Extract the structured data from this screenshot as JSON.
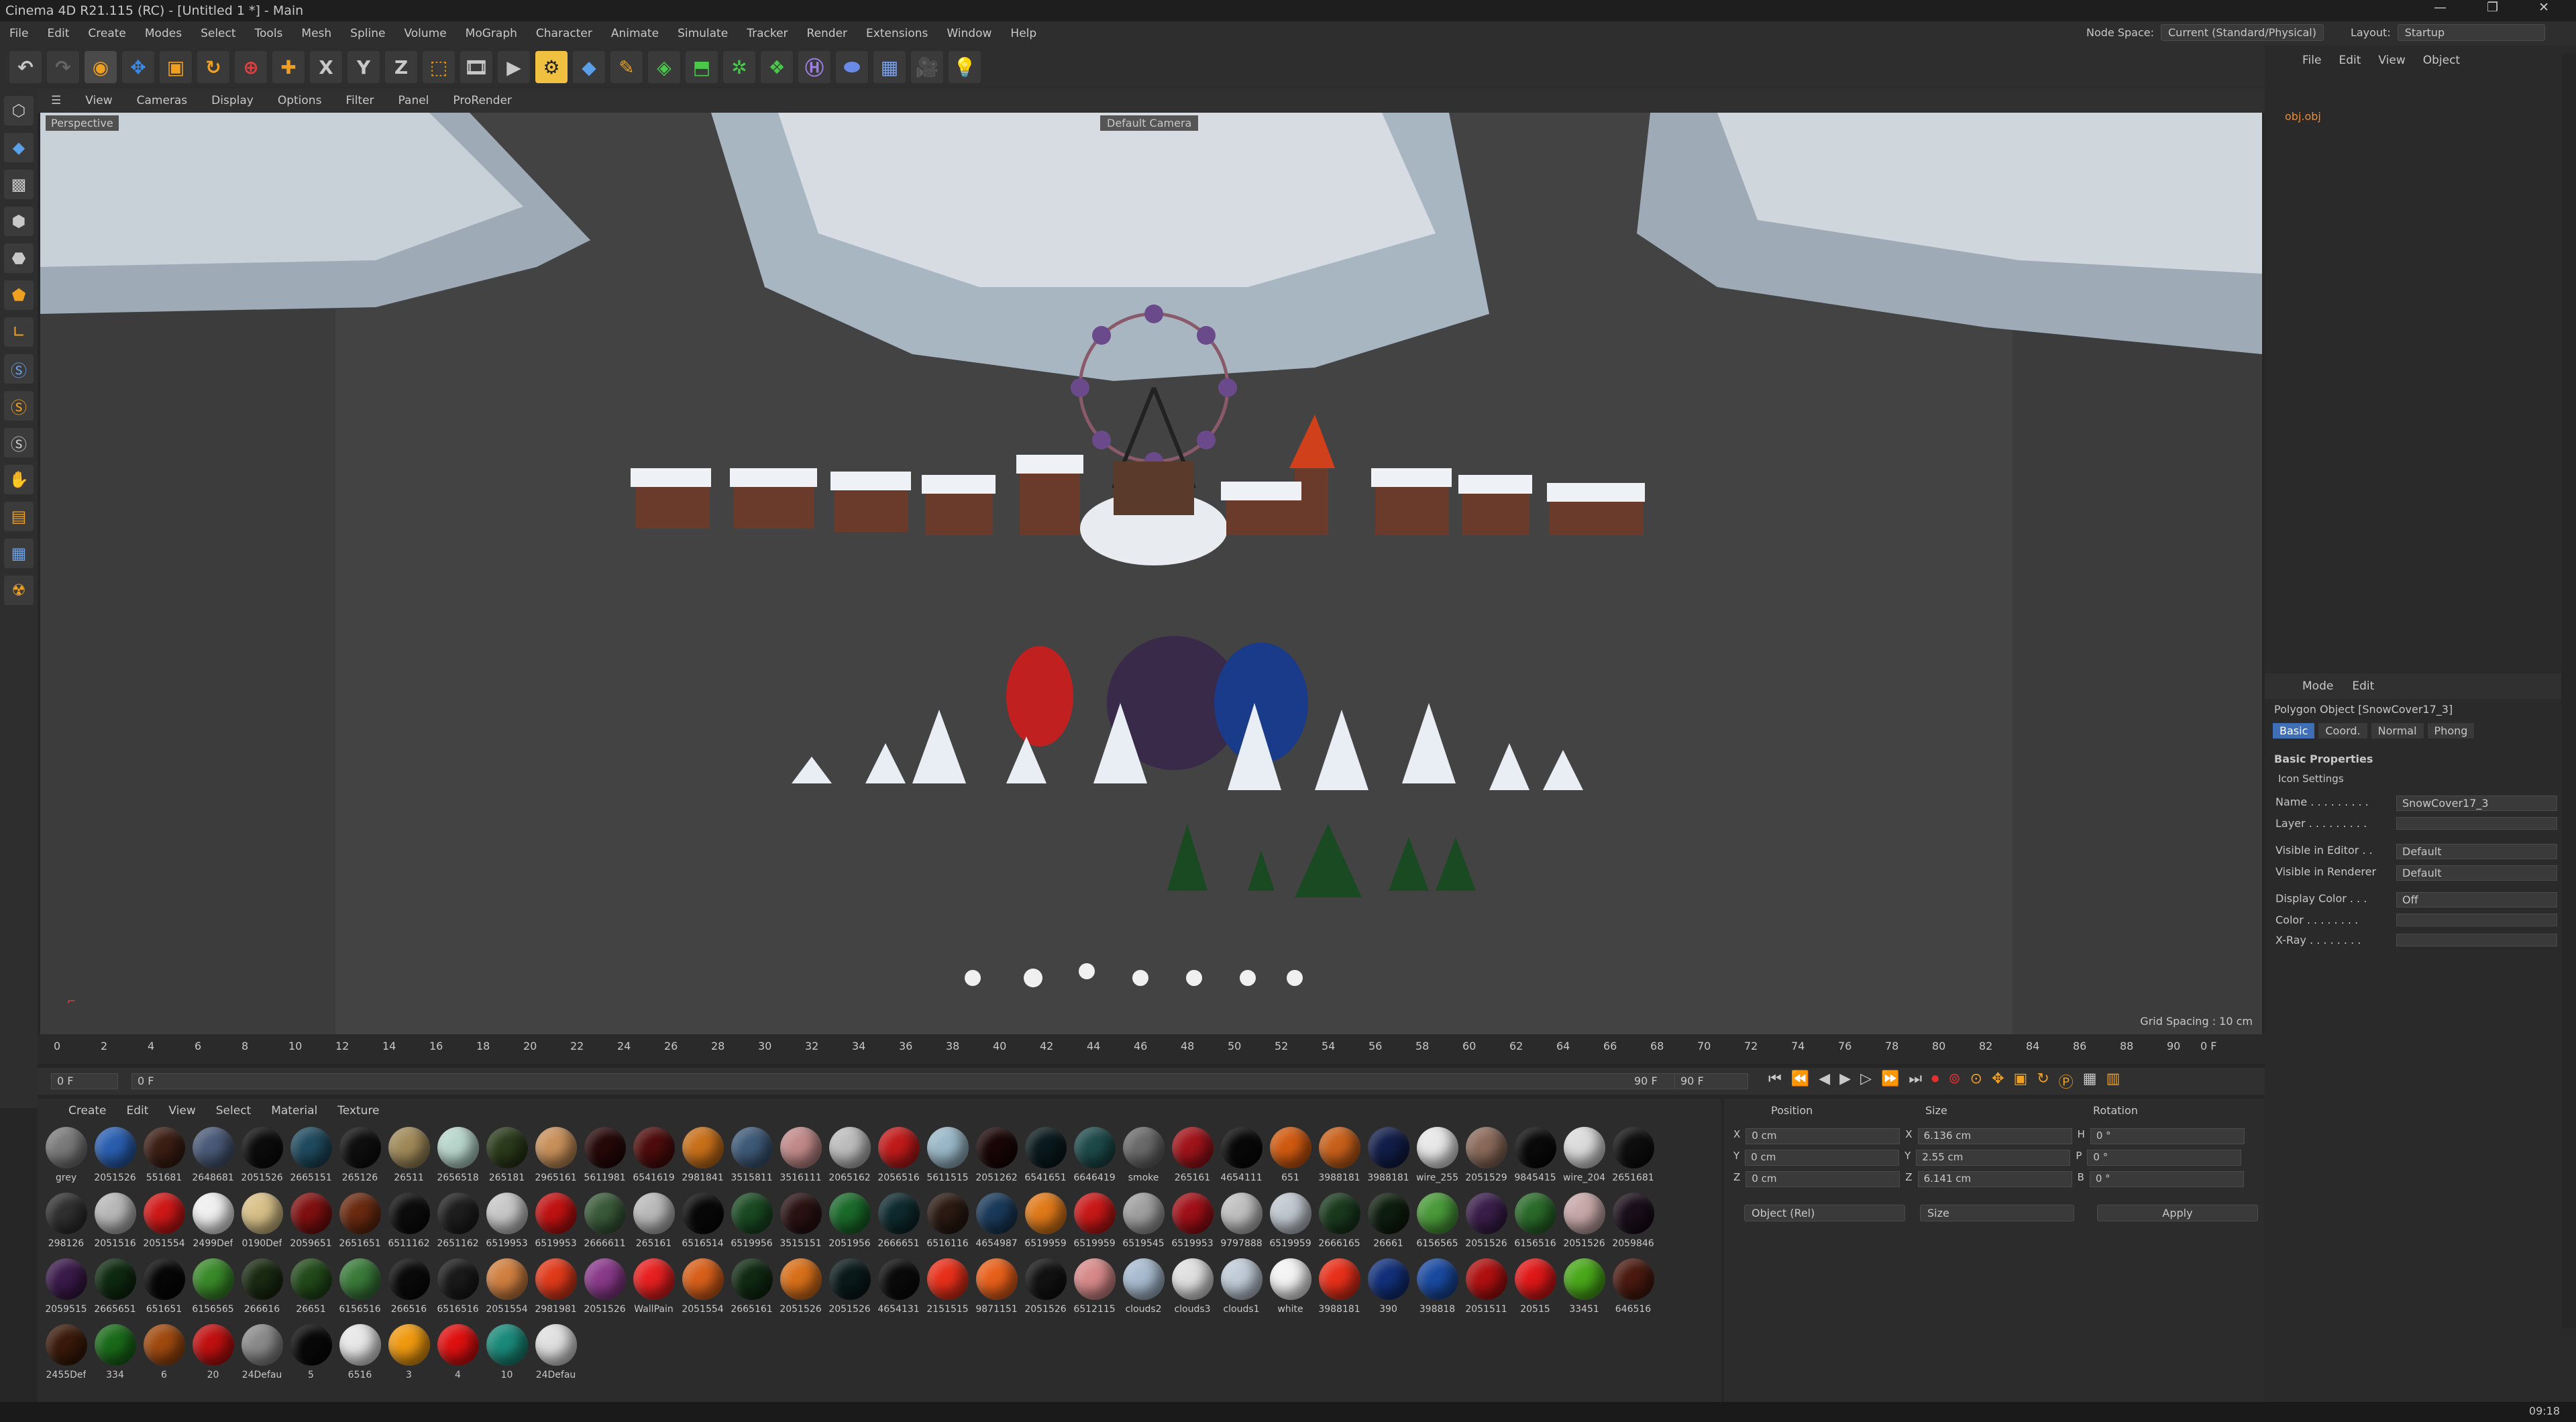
{
  "window": {
    "title": "Cinema 4D R21.115 (RC) - [Untitled 1 *] - Main"
  },
  "menu": [
    "File",
    "Edit",
    "Create",
    "Modes",
    "Select",
    "Tools",
    "Mesh",
    "Spline",
    "Volume",
    "MoGraph",
    "Character",
    "Animate",
    "Simulate",
    "Tracker",
    "Render",
    "Extensions",
    "Window",
    "Help"
  ],
  "node_space": {
    "label": "Node Space:",
    "value": "Current (Standard/Physical)"
  },
  "layout": {
    "label": "Layout:",
    "value": "Startup"
  },
  "toolbar": {
    "x": "X",
    "y": "Y",
    "z": "Z"
  },
  "viewport": {
    "menu": [
      "View",
      "Cameras",
      "Display",
      "Options",
      "Filter",
      "Panel",
      "ProRender"
    ],
    "label": "Perspective",
    "camera": "Default Camera",
    "grid": "Grid Spacing : 10 cm"
  },
  "timeline": {
    "ticks": [
      "0",
      "2",
      "4",
      "6",
      "8",
      "10",
      "12",
      "14",
      "16",
      "18",
      "20",
      "22",
      "24",
      "26",
      "28",
      "30",
      "32",
      "34",
      "36",
      "38",
      "40",
      "42",
      "44",
      "46",
      "48",
      "50",
      "52",
      "54",
      "56",
      "58",
      "60",
      "62",
      "64",
      "66",
      "68",
      "70",
      "72",
      "74",
      "76",
      "78",
      "80",
      "82",
      "84",
      "86",
      "88",
      "90"
    ],
    "end": "0 F",
    "start_frame": "0 F",
    "cur_frame": "0 F",
    "end_frame": "90 F",
    "max_frame": "90 F"
  },
  "materials": {
    "menu": [
      "Create",
      "Edit",
      "View",
      "Select",
      "Material",
      "Texture"
    ],
    "items": [
      {
        "n": "grey",
        "c": "#7a7a7a"
      },
      {
        "n": "2051526",
        "c": "#2a5fb0"
      },
      {
        "n": "551681",
        "c": "#3b1e14"
      },
      {
        "n": "2648681",
        "c": "#4a5a78"
      },
      {
        "n": "2051526",
        "c": "#0c0c0c"
      },
      {
        "n": "2665151",
        "c": "#1f4a5e"
      },
      {
        "n": "265126",
        "c": "#0f0f0f"
      },
      {
        "n": "26511",
        "c": "#a08a5a"
      },
      {
        "n": "2656518",
        "c": "#b8d6cc"
      },
      {
        "n": "265181",
        "c": "#2a3a1a"
      },
      {
        "n": "2965161",
        "c": "#c8905a"
      },
      {
        "n": "5611981",
        "c": "#260808"
      },
      {
        "n": "6541619",
        "c": "#4e0c0c"
      },
      {
        "n": "2981841",
        "c": "#c8701a"
      },
      {
        "n": "3515811",
        "c": "#3e5a78"
      },
      {
        "n": "3516111",
        "c": "#c28a8a"
      },
      {
        "n": "2065162",
        "c": "#bdbdbd"
      },
      {
        "n": "2056516",
        "c": "#c01a1a"
      },
      {
        "n": "5611515",
        "c": "#9ab8c8"
      },
      {
        "n": "2051262",
        "c": "#1a0606"
      },
      {
        "n": "6541651",
        "c": "#0a1a1e"
      },
      {
        "n": "6646419",
        "c": "#1e4a4a"
      },
      {
        "n": "smoke",
        "c": "#6a6a6a"
      },
      {
        "n": "265161",
        "c": "#a0141a"
      },
      {
        "n": "4654111",
        "c": "#080808"
      },
      {
        "n": "651",
        "c": "#d05a10"
      },
      {
        "n": "3988181",
        "c": "#c8601a"
      },
      {
        "n": "3988181",
        "c": "#121e4a"
      },
      {
        "n": "wire_255",
        "c": "#e8e8e8"
      },
      {
        "n": "2051529",
        "c": "#8a6a5a"
      },
      {
        "n": "9845415",
        "c": "#0a0a0a"
      },
      {
        "n": "wire_204",
        "c": "#dcdcdc"
      },
      {
        "n": "2651681",
        "c": "#0e0e0e"
      },
      {
        "n": "298126",
        "c": "#303030"
      },
      {
        "n": "2051516",
        "c": "#b8b8b8"
      },
      {
        "n": "2051554",
        "c": "#d01818"
      },
      {
        "n": "2499Def",
        "c": "#f0f0f0"
      },
      {
        "n": "0190Def",
        "c": "#d8c088"
      },
      {
        "n": "2059651",
        "c": "#801010"
      },
      {
        "n": "2651651",
        "c": "#6a2a10"
      },
      {
        "n": "6511162",
        "c": "#0c0c0c"
      },
      {
        "n": "2651162",
        "c": "#1e1e1e"
      },
      {
        "n": "6519953",
        "c": "#c8c8c8"
      },
      {
        "n": "6519953",
        "c": "#c01212"
      },
      {
        "n": "2666611",
        "c": "#3a5a3a"
      },
      {
        "n": "265161",
        "c": "#bababa"
      },
      {
        "n": "6516514",
        "c": "#080808"
      },
      {
        "n": "6519956",
        "c": "#1a4a22"
      },
      {
        "n": "3515151",
        "c": "#2a1212"
      },
      {
        "n": "2051956",
        "c": "#1a6a2a"
      },
      {
        "n": "2666651",
        "c": "#0e2a2e"
      },
      {
        "n": "6516116",
        "c": "#2a1a12"
      },
      {
        "n": "4654987",
        "c": "#1a3a5a"
      },
      {
        "n": "6519959",
        "c": "#e07a1a"
      },
      {
        "n": "6519959",
        "c": "#c81818"
      },
      {
        "n": "6519545",
        "c": "#a0a0a0"
      },
      {
        "n": "6519953",
        "c": "#a01018"
      },
      {
        "n": "9797888",
        "c": "#c0c0c0"
      },
      {
        "n": "6519959",
        "c": "#c0c8d0"
      },
      {
        "n": "2666165",
        "c": "#1a3a1e"
      },
      {
        "n": "26661",
        "c": "#0e1e0e"
      },
      {
        "n": "6156565",
        "c": "#4a9a3a"
      },
      {
        "n": "2051526",
        "c": "#3a1e4a"
      },
      {
        "n": "6156516",
        "c": "#2a6a2a"
      },
      {
        "n": "2051526",
        "c": "#c8a8a8"
      },
      {
        "n": "2059846",
        "c": "#1a0e1a"
      },
      {
        "n": "2059515",
        "c": "#3a1a4a"
      },
      {
        "n": "2665651",
        "c": "#0e2a10"
      },
      {
        "n": "651651",
        "c": "#060606"
      },
      {
        "n": "6156565",
        "c": "#3a8a2a"
      },
      {
        "n": "266616",
        "c": "#1a2a12"
      },
      {
        "n": "26651",
        "c": "#224a1a"
      },
      {
        "n": "6156516",
        "c": "#3a7a3a"
      },
      {
        "n": "266516",
        "c": "#0a0a0a"
      },
      {
        "n": "6516516",
        "c": "#1a1a1a"
      },
      {
        "n": "2051554",
        "c": "#d08040"
      },
      {
        "n": "2981981",
        "c": "#e03a1a"
      },
      {
        "n": "2051526",
        "c": "#8a3a8a"
      },
      {
        "n": "WallPain",
        "c": "#e82020"
      },
      {
        "n": "2051554",
        "c": "#d8601a"
      },
      {
        "n": "2665161",
        "c": "#102a12"
      },
      {
        "n": "2051526",
        "c": "#d8701a"
      },
      {
        "n": "2051526",
        "c": "#0a1a1a"
      },
      {
        "n": "4654131",
        "c": "#0a0a0a"
      },
      {
        "n": "2151515",
        "c": "#e8301a"
      },
      {
        "n": "9871151",
        "c": "#e8601a"
      },
      {
        "n": "2051526",
        "c": "#121212"
      },
      {
        "n": "6512115",
        "c": "#d88a8a"
      },
      {
        "n": "clouds2",
        "c": "#a8bcd0"
      },
      {
        "n": "clouds3",
        "c": "#e0e0e0"
      },
      {
        "n": "clouds1",
        "c": "#c0ccd8"
      },
      {
        "n": "white",
        "c": "#f4f4f4"
      },
      {
        "n": "3988181",
        "c": "#e8301a"
      },
      {
        "n": "390",
        "c": "#12307a"
      },
      {
        "n": "398818",
        "c": "#1a4aa0"
      },
      {
        "n": "2051511",
        "c": "#b01010"
      },
      {
        "n": "20515",
        "c": "#e01818"
      },
      {
        "n": "33451",
        "c": "#4aa81a"
      },
      {
        "n": "646516",
        "c": "#4a1a10"
      },
      {
        "n": "2455Def",
        "c": "#3a1a0a"
      },
      {
        "n": "334",
        "c": "#1a6a1a"
      },
      {
        "n": "6",
        "c": "#a04a10"
      },
      {
        "n": "20",
        "c": "#c01010"
      },
      {
        "n": "24Defau",
        "c": "#8a8a8a"
      },
      {
        "n": "5",
        "c": "#080808"
      },
      {
        "n": "6516",
        "c": "#e8e8e8"
      },
      {
        "n": "3",
        "c": "#f09a10"
      },
      {
        "n": "4",
        "c": "#e01010"
      },
      {
        "n": "10",
        "c": "#1a8a7a"
      },
      {
        "n": "24Defau",
        "c": "#e0e0e0"
      }
    ]
  },
  "coords": {
    "position": "Position",
    "size": "Size",
    "rotation": "Rotation",
    "rows": [
      {
        "a": "X",
        "p": "0 cm",
        "b": "X",
        "s": "6.136 cm",
        "c": "H",
        "r": "0 °"
      },
      {
        "a": "Y",
        "p": "0 cm",
        "b": "Y",
        "s": "2.55 cm",
        "c": "P",
        "r": "0 °"
      },
      {
        "a": "Z",
        "p": "0 cm",
        "b": "Z",
        "s": "6.141 cm",
        "c": "B",
        "r": "0 °"
      }
    ],
    "mode": "Object (Rel)",
    "size_mode": "Size",
    "apply": "Apply"
  },
  "objects": {
    "menu": [
      "File",
      "Edit",
      "View",
      "Object"
    ],
    "item": "obj.obj"
  },
  "attributes": {
    "menu": [
      "Mode",
      "Edit"
    ],
    "header": "Polygon Object [SnowCover17_3]",
    "tabs": [
      "Basic",
      "Coord.",
      "Normal",
      "Phong"
    ],
    "section": "Basic Properties",
    "icon_settings": "Icon Settings",
    "fields": [
      {
        "l": "Name . . . . . . . . .",
        "v": "SnowCover17_3"
      },
      {
        "l": "Layer . . . . . . . . .",
        "v": ""
      },
      {
        "l": "Visible in Editor . .",
        "v": "Default"
      },
      {
        "l": "Visible in Renderer",
        "v": "Default"
      },
      {
        "l": "Display Color . . .",
        "v": "Off"
      },
      {
        "l": "Color . . . . . . . .",
        "v": ""
      },
      {
        "l": "X-Ray . . . . . . . .",
        "v": ""
      }
    ]
  },
  "status": {
    "clock": "09:18"
  }
}
